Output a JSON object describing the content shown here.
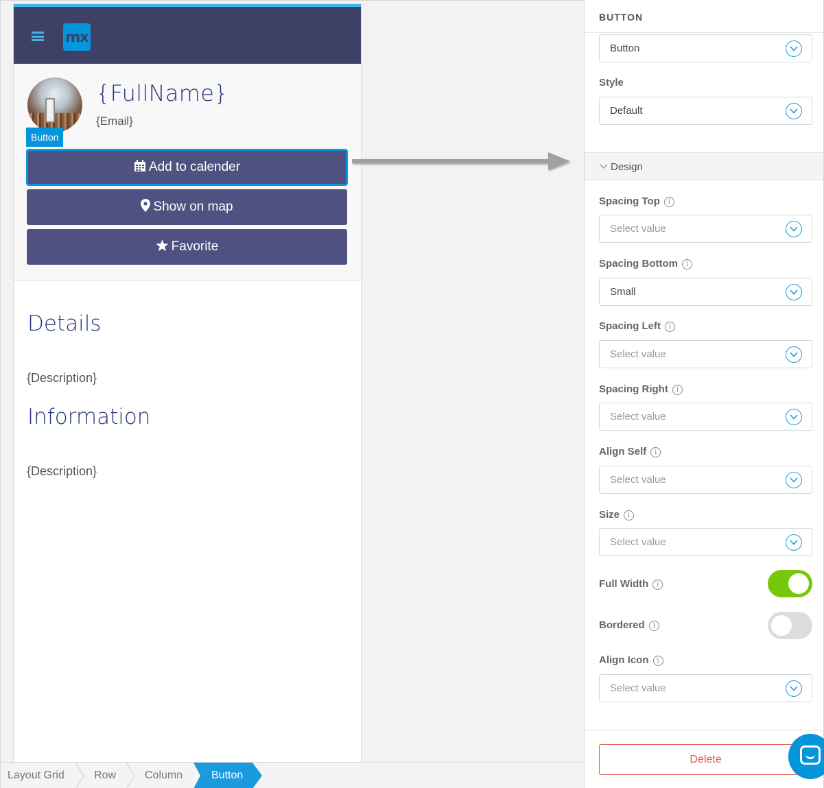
{
  "canvas": {
    "logo_text": "mx",
    "profile": {
      "fullname": "{FullName}",
      "email": "{Email}",
      "selection_tag": "Button"
    },
    "buttons": [
      {
        "label": "Add to calender",
        "icon": "calendar-icon"
      },
      {
        "label": "Show on map",
        "icon": "map-marker-icon"
      },
      {
        "label": "Favorite",
        "icon": "star-icon"
      }
    ],
    "sections": [
      {
        "heading": "Details",
        "text": "{Description}"
      },
      {
        "heading": "Information",
        "text": "{Description}"
      }
    ]
  },
  "breadcrumb": {
    "items": [
      "Layout Grid",
      "Row",
      "Column"
    ],
    "active": "Button"
  },
  "panel": {
    "title": "BUTTON",
    "type_select": "Button",
    "style": {
      "label": "Style",
      "value": "Default"
    },
    "design_section": "Design",
    "fields": [
      {
        "label": "Spacing Top",
        "value": "Select value"
      },
      {
        "label": "Spacing Bottom",
        "value": "Small"
      },
      {
        "label": "Spacing Left",
        "value": "Select value"
      },
      {
        "label": "Spacing Right",
        "value": "Select value"
      },
      {
        "label": "Align Self",
        "value": "Select value"
      },
      {
        "label": "Size",
        "value": "Select value"
      }
    ],
    "toggles": [
      {
        "label": "Full Width",
        "on": true
      },
      {
        "label": "Bordered",
        "on": false
      }
    ],
    "align_icon": {
      "label": "Align Icon",
      "value": "Select value"
    },
    "delete_label": "Delete"
  },
  "colors": {
    "navbar": "#3d4166",
    "button": "#4f5180",
    "accent": "#0595db",
    "heading": "#26367a",
    "toggle_on": "#76c80a",
    "delete": "#e05a50"
  }
}
